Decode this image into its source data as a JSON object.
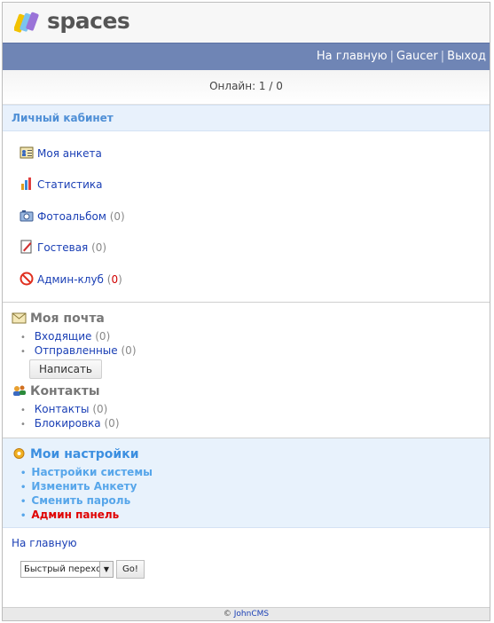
{
  "brand": {
    "name": "spaces"
  },
  "nav": {
    "home": "На главную",
    "user": "Gaucer",
    "logout": "Выход",
    "separator": "|"
  },
  "online": {
    "text": "Онлайн: 1 / 0"
  },
  "cabinet": {
    "title": "Личный кабинет",
    "items": [
      {
        "label": "Моя анкета",
        "count": "",
        "icon": "profile-icon"
      },
      {
        "label": "Статистика",
        "count": "",
        "icon": "stats-icon"
      },
      {
        "label": "Фотоальбом",
        "count": "(0)",
        "icon": "photo-icon"
      },
      {
        "label": "Гостевая",
        "count": "(0)",
        "icon": "guestbook-icon"
      },
      {
        "label": "Админ-клуб",
        "count_open": "(",
        "count_value": "0",
        "count_close": ")",
        "icon": "no-entry-icon"
      }
    ]
  },
  "mail": {
    "title": "Моя почта",
    "inbox": {
      "label": "Входящие",
      "count": "(0)"
    },
    "sent": {
      "label": "Отправленные",
      "count": "(0)"
    },
    "write_button": "Написать"
  },
  "contacts": {
    "title": "Контакты",
    "items": [
      {
        "label": "Контакты",
        "count": "(0)"
      },
      {
        "label": "Блокировка",
        "count": "(0)"
      }
    ]
  },
  "settings": {
    "title": "Мои настройки",
    "items": [
      {
        "label": "Настройки системы"
      },
      {
        "label": "Изменить Анкету"
      },
      {
        "label": "Сменить пароль"
      },
      {
        "label": "Админ панель"
      }
    ]
  },
  "bottom": {
    "home_link": "На главную",
    "quick_jump": "Быстрый переход",
    "go_button": "Go!"
  },
  "footer": {
    "copyright": "©",
    "link": "JohnCMS"
  },
  "colors": {
    "nav_bar": "#6f85b5",
    "section_bg": "#e8f1fc",
    "link": "#1a3fb5",
    "admin_red": "#e00000"
  }
}
